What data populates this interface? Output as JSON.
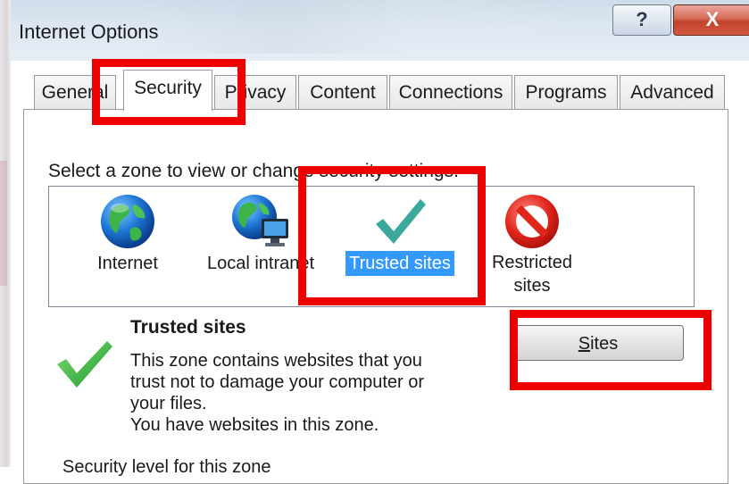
{
  "window": {
    "title": "Internet Options",
    "help_glyph": "?",
    "close_glyph": "X"
  },
  "tabs": [
    {
      "label": "General",
      "active": false
    },
    {
      "label": "Security",
      "active": true
    },
    {
      "label": "Privacy",
      "active": false
    },
    {
      "label": "Content",
      "active": false
    },
    {
      "label": "Connections",
      "active": false
    },
    {
      "label": "Programs",
      "active": false
    },
    {
      "label": "Advanced",
      "active": false
    }
  ],
  "security": {
    "zone_prompt": "Select a zone to view or change security settings.",
    "zones": [
      {
        "label": "Internet",
        "icon": "globe-icon",
        "selected": false
      },
      {
        "label": "Local intranet",
        "icon": "intranet-globe-icon",
        "selected": false
      },
      {
        "label": "Trusted sites",
        "icon": "checkmark-icon",
        "selected": true
      },
      {
        "label_line1": "Restricted",
        "label_line2": "sites",
        "icon": "no-entry-icon",
        "selected": false
      }
    ],
    "info": {
      "title": "Trusted sites",
      "line1": "This zone contains websites that you",
      "line2": "trust not to damage your computer or",
      "line3": "your files.",
      "line4": "You have websites in this zone."
    },
    "sites_button": {
      "underlined": "S",
      "rest": "ites"
    },
    "level_label": "Security level for this zone"
  },
  "colors": {
    "highlight": "#ee0000",
    "selection": "#3399ff",
    "close_button": "#c0412c",
    "checkmark_teal": "#3aa89a",
    "checkmark_green": "#3db54a"
  }
}
